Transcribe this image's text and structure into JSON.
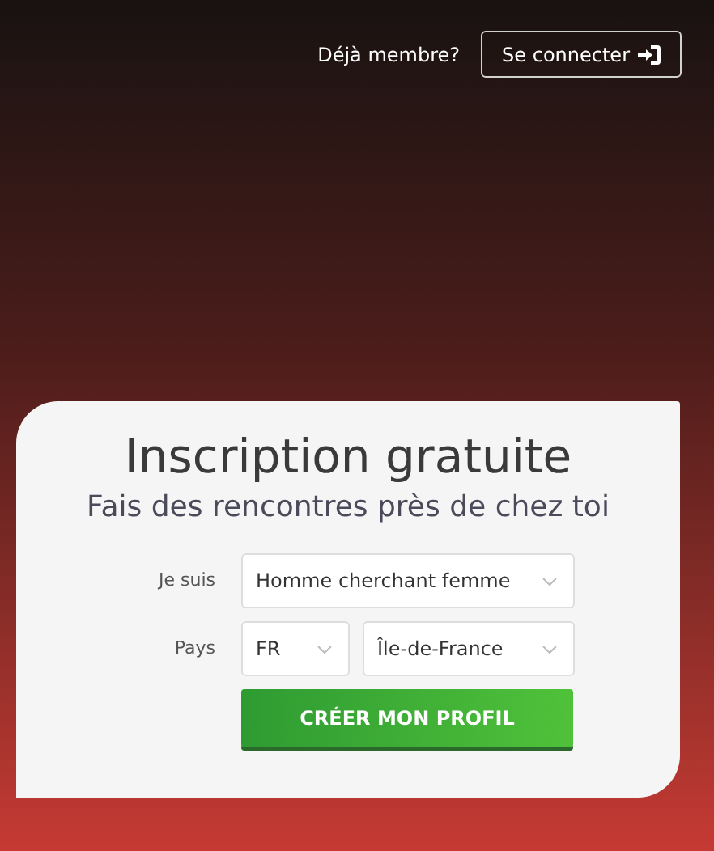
{
  "header": {
    "prompt": "Déjà membre?",
    "login_button": "Se connecter"
  },
  "card": {
    "title": "Inscription gratuite",
    "subtitle": "Fais des rencontres près de chez toi",
    "fields": [
      {
        "label": "Je suis",
        "selects": [
          {
            "value": "Homme cherchant femme"
          }
        ]
      },
      {
        "label": "Pays",
        "selects": [
          {
            "value": "FR"
          },
          {
            "value": "Île-de-France"
          }
        ]
      }
    ],
    "submit": "CRÉER MON PROFIL"
  }
}
